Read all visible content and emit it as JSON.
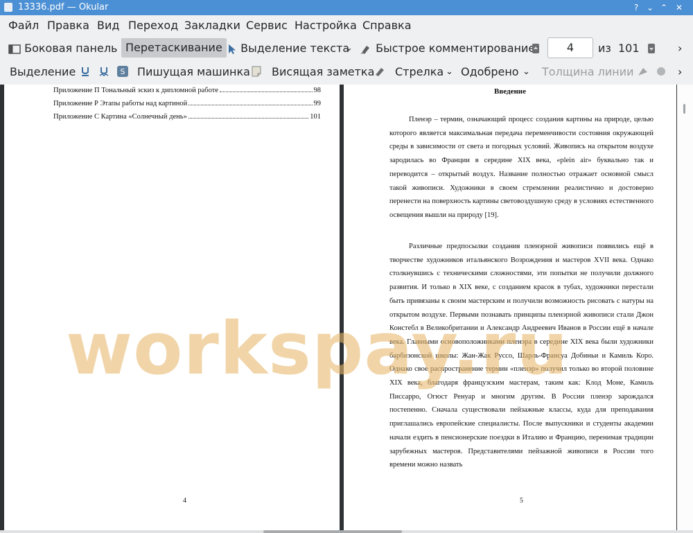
{
  "window": {
    "title": "13336.pdf  — Okular",
    "btn_help": "?",
    "btn_min": "⌄",
    "btn_max": "⌃",
    "btn_close": "✕"
  },
  "menu": [
    "Файл",
    "Правка",
    "Вид",
    "Переход",
    "Закладки",
    "Сервис",
    "Настройка",
    "Справка"
  ],
  "toolbar1": {
    "sidebar": "Боковая панель",
    "drag": "Перетаскивание",
    "text_select": "Выделение текста",
    "quick_comment": "Быстрое комментирование",
    "page_value": "4",
    "of_label": "из",
    "page_total": "101"
  },
  "toolbar2": {
    "selection": "Выделение",
    "typewriter": "Пишущая машинка",
    "hanging_note": "Висящая заметка",
    "arrow": "Стрелка",
    "approved": "Одобрено",
    "line_width": "Толщина линии"
  },
  "left_page": {
    "toc": [
      {
        "title": "Приложение П Тональный эскиз к дипломной работе",
        "page": "98"
      },
      {
        "title": "Приложение Р Этапы работы над картиной",
        "page": "99"
      },
      {
        "title": "Приложение С Картина «Солнечный день»",
        "page": "101"
      }
    ],
    "page_number": "4"
  },
  "right_page": {
    "heading": "Введение",
    "para1": "Пленэр – термин, означающий процесс создания картины на природе, целью которого является максимальная передача переменчивости состояния окружающей среды в зависимости от света и погодных условий. Живопись на открытом воздухе зародилась во Франции в середине XIX века, «plein air» буквально так и переводится – открытый воздух. Название полностью отражает основной смысл такой живописи. Художники в своем стремлении реалистично и достоверно перенести на поверхность картины световоздушную среду в условиях естественного освещения вышли на природу [19].",
    "para2": "Различные предпосылки создания пленэрной живописи появились ещё в творчестве художников итальянского Возрождения и мастеров XVII века. Однако столкнувшись с техническими сложностями, эти попытки не получили должного развития. И только в XIX веке, с созданием красок в тубах, художники перестали быть привязаны к своим мастерским и получили возможность рисовать с натуры на открытом воздухе. Первыми познавать принципы пленэрной живописи стали Джон Констебл в Великобритании и Александр Андреевич Иванов в России ещё в начале века. Главными основоположниками пленэра в середине XIX века были художники барбизонской школы: Жан-Жак Руссо, Шарль-Франсуа Добиньи и Камиль Коро. Однако свое распространение термин «пленэр» получил только во второй половине XIX века, благодаря французским мастерам, таким как: Клод Моне, Камиль Писсарро, Огюст Ренуар и многим другим. В России пленэр зарождался постепенно. Сначала существовали пейзажные классы, куда для преподавания приглашались европейские специалисты. После выпускники и студенты академии начали ездить в пенсионерские поездки в Италию и Францию, перенимая традиции зарубежных мастеров. Представителями пейзажной живописи в России того времени можно назвать",
    "page_number": "5"
  },
  "watermark": "workspay.ru",
  "colors": {
    "titlebar": "#4b8fd4",
    "viewer_bg": "#2f3235",
    "watermark": "#e7b86c"
  }
}
